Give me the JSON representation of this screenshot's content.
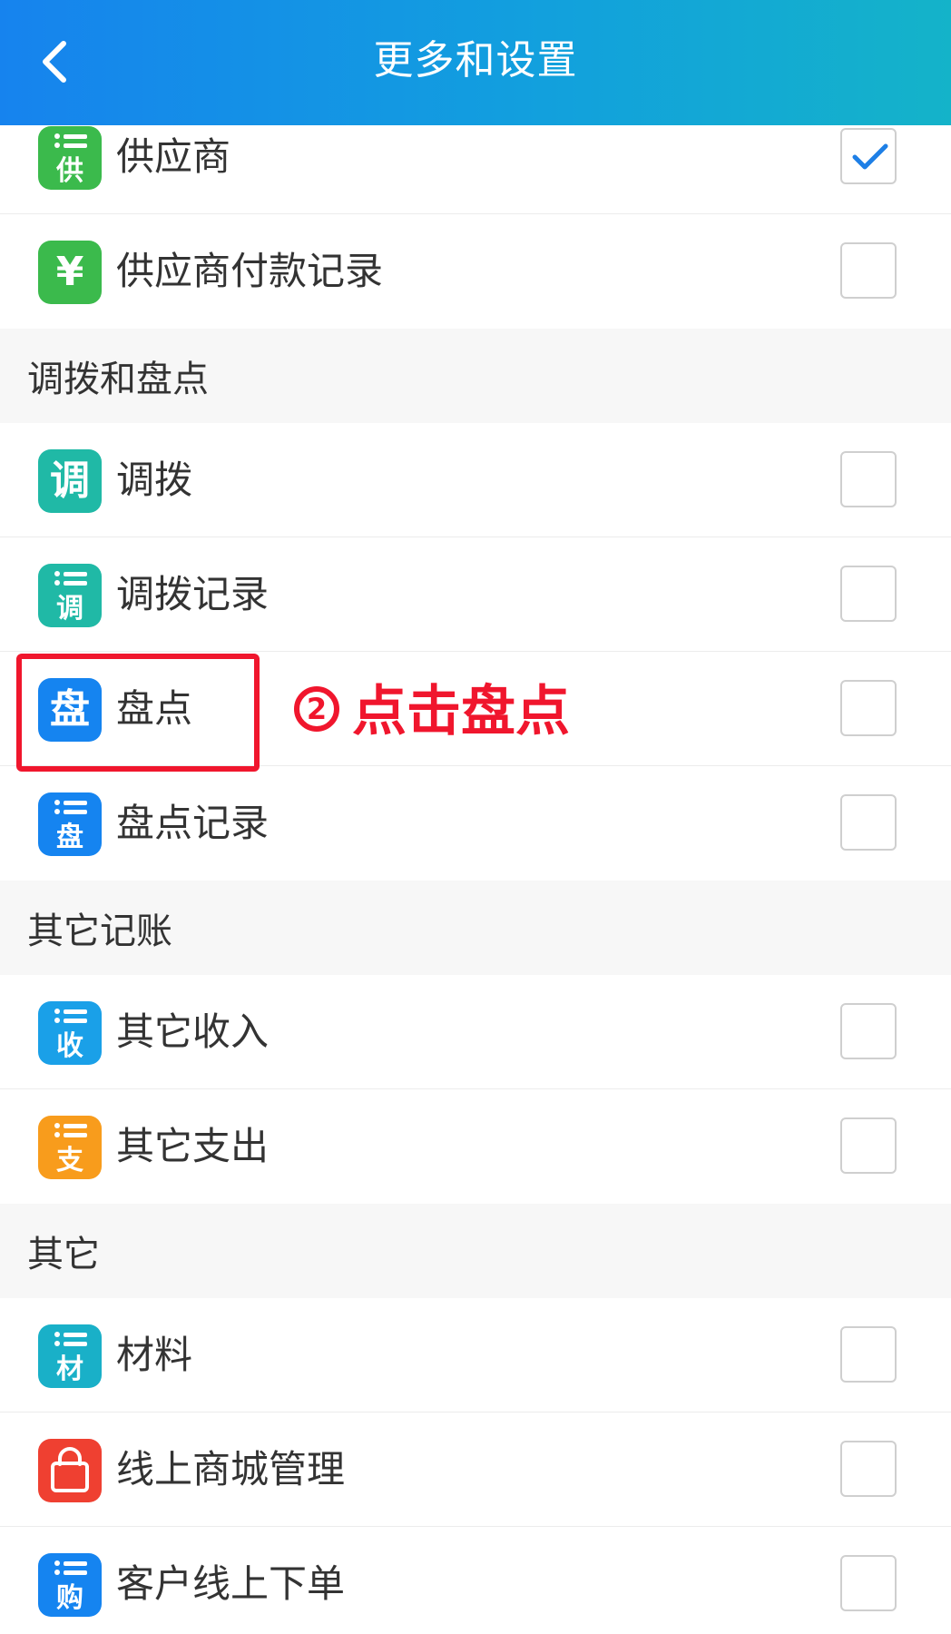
{
  "header": {
    "title": "更多和设置",
    "back_icon": "chevron-left-icon"
  },
  "colors": {
    "header_gradient_start": "#1683ee",
    "header_gradient_end": "#14b3c9",
    "check_color": "#1e7fe6",
    "annotation_red": "#f0162d",
    "green": "#3bba4c",
    "teal": "#20b9a6",
    "blue": "#1584f0",
    "sky": "#1aa0e8",
    "orange": "#f89c1c",
    "cyan": "#19b0c8",
    "red": "#ef4031"
  },
  "groups": {
    "supplier": {
      "items": [
        {
          "label": "供应商",
          "icon_char": "供",
          "icon": "supplier-list-icon",
          "checked": true
        },
        {
          "label": "供应商付款记录",
          "icon_char": "¥",
          "icon": "yuan-icon",
          "checked": false
        }
      ]
    },
    "transfer": {
      "title": "调拨和盘点",
      "items": [
        {
          "label": "调拨",
          "icon_char": "调",
          "icon": "transfer-icon",
          "checked": false
        },
        {
          "label": "调拨记录",
          "icon_char": "调",
          "icon": "transfer-list-icon",
          "checked": false
        },
        {
          "label": "盘点",
          "icon_char": "盘",
          "icon": "inventory-icon",
          "checked": false
        },
        {
          "label": "盘点记录",
          "icon_char": "盘",
          "icon": "inventory-list-icon",
          "checked": false
        }
      ]
    },
    "other_accounting": {
      "title": "其它记账",
      "items": [
        {
          "label": "其它收入",
          "icon_char": "收",
          "icon": "income-list-icon",
          "checked": false
        },
        {
          "label": "其它支出",
          "icon_char": "支",
          "icon": "expense-list-icon",
          "checked": false
        }
      ]
    },
    "other": {
      "title": "其它",
      "items": [
        {
          "label": "材料",
          "icon_char": "材",
          "icon": "material-list-icon",
          "checked": false
        },
        {
          "label": "线上商城管理",
          "icon_char": "",
          "icon": "shopping-bag-icon",
          "checked": false
        },
        {
          "label": "客户线上下单",
          "icon_char": "购",
          "icon": "purchase-list-icon",
          "checked": false
        }
      ]
    }
  },
  "annotation": {
    "step_number": "2",
    "text": "点击盘点"
  }
}
